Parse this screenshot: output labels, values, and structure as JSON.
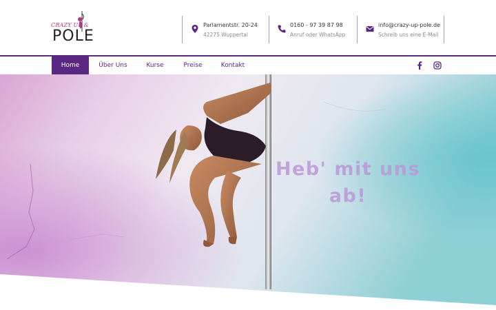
{
  "brand": {
    "logo_small": "CRAZY UP &",
    "logo_main": "POLE"
  },
  "contacts": [
    {
      "icon": "map-pin-icon",
      "line1": "Parlamentstr. 20-24",
      "line2": "42275 Wuppertal"
    },
    {
      "icon": "phone-icon",
      "line1": "0160 - 97 39 87 98",
      "line2": "Anruf oder WhatsApp"
    },
    {
      "icon": "envelope-icon",
      "line1": "info@crazy-up-pole.de",
      "line2": "Schreib uns eine E-Mail"
    }
  ],
  "nav": {
    "items": [
      {
        "label": "Home",
        "active": true
      },
      {
        "label": "Über Uns",
        "active": false
      },
      {
        "label": "Kurse",
        "active": false
      },
      {
        "label": "Preise",
        "active": false
      },
      {
        "label": "Kontakt",
        "active": false
      }
    ],
    "social": [
      "facebook-icon",
      "instagram-icon"
    ]
  },
  "hero": {
    "line1": "Heb' mit uns",
    "line2": "ab!"
  },
  "colors": {
    "brand_purple": "#5a2782",
    "logo_pink": "#b3368f",
    "divider": "#a99bbd"
  }
}
